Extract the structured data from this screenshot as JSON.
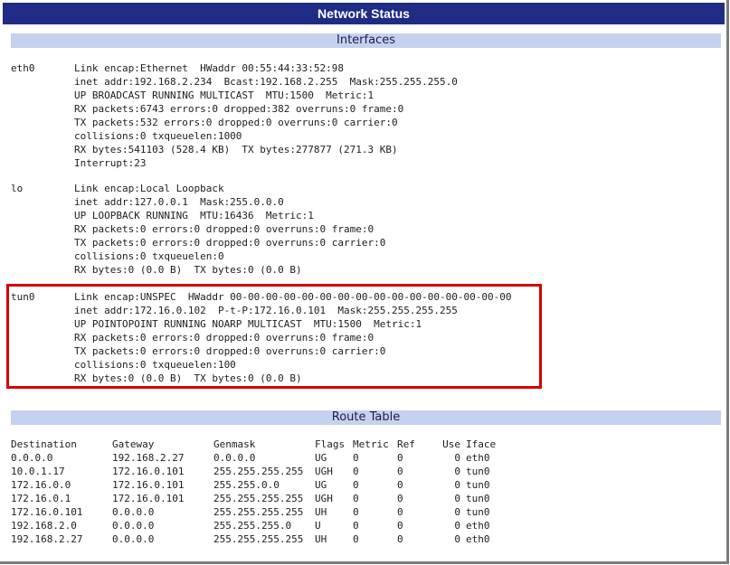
{
  "window": {
    "title": "Network Status"
  },
  "interfaces_section": {
    "title": "Interfaces",
    "interfaces": [
      {
        "name": "eth0",
        "lines": [
          "Link encap:Ethernet  HWaddr 00:55:44:33:52:98",
          "inet addr:192.168.2.234  Bcast:192.168.2.255  Mask:255.255.255.0",
          "UP BROADCAST RUNNING MULTICAST  MTU:1500  Metric:1",
          "RX packets:6743 errors:0 dropped:382 overruns:0 frame:0",
          "TX packets:532 errors:0 dropped:0 overruns:0 carrier:0",
          "collisions:0 txqueuelen:1000",
          "RX bytes:541103 (528.4 KB)  TX bytes:277877 (271.3 KB)",
          "Interrupt:23"
        ]
      },
      {
        "name": "lo",
        "lines": [
          "Link encap:Local Loopback",
          "inet addr:127.0.0.1  Mask:255.0.0.0",
          "UP LOOPBACK RUNNING  MTU:16436  Metric:1",
          "RX packets:0 errors:0 dropped:0 overruns:0 frame:0",
          "TX packets:0 errors:0 dropped:0 overruns:0 carrier:0",
          "collisions:0 txqueuelen:0",
          "RX bytes:0 (0.0 B)  TX bytes:0 (0.0 B)"
        ]
      },
      {
        "name": "tun0",
        "lines": [
          "Link encap:UNSPEC  HWaddr 00-00-00-00-00-00-00-00-00-00-00-00-00-00-00-00",
          "inet addr:172.16.0.102  P-t-P:172.16.0.101  Mask:255.255.255.255",
          "UP POINTOPOINT RUNNING NOARP MULTICAST  MTU:1500  Metric:1",
          "RX packets:0 errors:0 dropped:0 overruns:0 frame:0",
          "TX packets:0 errors:0 dropped:0 overruns:0 carrier:0",
          "collisions:0 txqueuelen:100",
          "RX bytes:0 (0.0 B)  TX bytes:0 (0.0 B)"
        ]
      }
    ]
  },
  "route_section": {
    "title": "Route Table",
    "headers": [
      "Destination",
      "Gateway",
      "Genmask",
      "Flags",
      "Metric",
      "Ref",
      "Use",
      "Iface"
    ],
    "rows": [
      [
        "0.0.0.0",
        "192.168.2.27",
        "0.0.0.0",
        "UG",
        "0",
        "0",
        "0",
        "eth0"
      ],
      [
        "10.0.1.17",
        "172.16.0.101",
        "255.255.255.255",
        "UGH",
        "0",
        "0",
        "0",
        "tun0"
      ],
      [
        "172.16.0.0",
        "172.16.0.101",
        "255.255.0.0",
        "UG",
        "0",
        "0",
        "0",
        "tun0"
      ],
      [
        "172.16.0.1",
        "172.16.0.101",
        "255.255.255.255",
        "UGH",
        "0",
        "0",
        "0",
        "tun0"
      ],
      [
        "172.16.0.101",
        "0.0.0.0",
        "255.255.255.255",
        "UH",
        "0",
        "0",
        "0",
        "tun0"
      ],
      [
        "192.168.2.0",
        "0.0.0.0",
        "255.255.255.0",
        "U",
        "0",
        "0",
        "0",
        "eth0"
      ],
      [
        "192.168.2.27",
        "0.0.0.0",
        "255.255.255.255",
        "UH",
        "0",
        "0",
        "0",
        "eth0"
      ]
    ]
  },
  "highlight": {
    "color": "#d60000",
    "interface": "tun0"
  }
}
